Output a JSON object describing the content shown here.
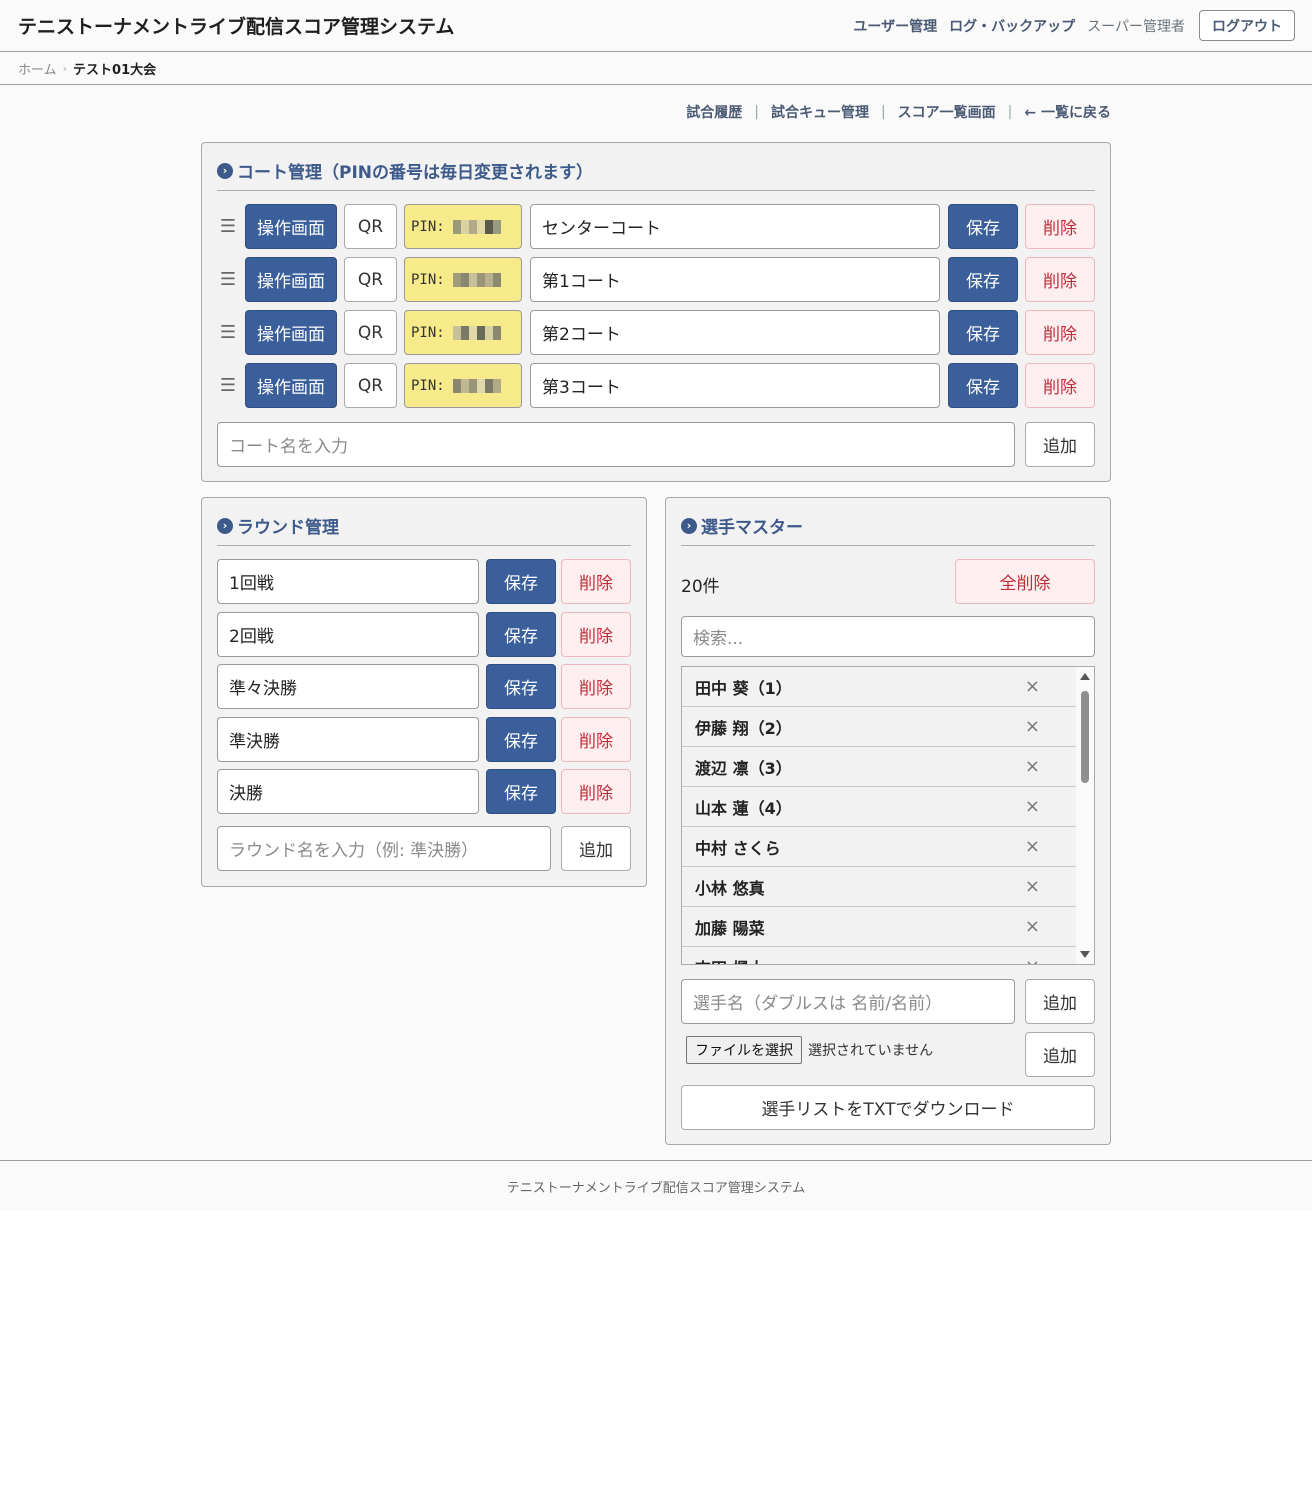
{
  "header": {
    "title": "テニストーナメントライブ配信スコア管理システム",
    "links": {
      "users": "ユーザー管理",
      "logs": "ログ・バックアップ"
    },
    "user_label": "スーパー管理者",
    "logout_label": "ログアウト"
  },
  "breadcrumb": {
    "home": "ホーム",
    "separator": "›",
    "current": "テスト01大会"
  },
  "subnav": {
    "history": "試合履歴",
    "queue": "試合キュー管理",
    "scores": "スコア一覧画面",
    "back": "← 一覧に戻る",
    "separator": "|"
  },
  "court_card": {
    "title": "コート管理（PINの番号は毎日変更されます）",
    "control_label": "操作画面",
    "qr_label": "QR",
    "pin_prefix": "PIN:",
    "save_label": "保存",
    "delete_label": "削除",
    "courts": [
      {
        "name": "センターコート"
      },
      {
        "name": "第1コート"
      },
      {
        "name": "第2コート"
      },
      {
        "name": "第3コート"
      }
    ],
    "new_placeholder": "コート名を入力",
    "add_label": "追加"
  },
  "round_card": {
    "title": "ラウンド管理",
    "save_label": "保存",
    "delete_label": "削除",
    "rounds": [
      "1回戦",
      "2回戦",
      "準々決勝",
      "準決勝",
      "決勝"
    ],
    "new_placeholder": "ラウンド名を入力（例: 準決勝）",
    "add_label": "追加"
  },
  "player_card": {
    "title": "選手マスター",
    "count": "20件",
    "delete_all_label": "全削除",
    "search_placeholder": "検索...",
    "players": [
      "田中 葵（1）",
      "伊藤 翔（2）",
      "渡辺 凛（3）",
      "山本 蓮（4）",
      "中村 さくら",
      "小林 悠真",
      "加藤 陽菜",
      "吉田 楓太"
    ],
    "remove_icon": "×",
    "name_placeholder": "選手名（ダブルスは 名前/名前）",
    "add_label": "追加",
    "file_button": "ファイルを選択",
    "file_status": "選択されていません",
    "file_add_label": "追加",
    "download_label": "選手リストをTXTでダウンロード"
  },
  "footer": {
    "text": "テニストーナメントライブ配信スコア管理システム"
  },
  "colors": {
    "primary": "#3a5f9a",
    "title": "#3d5a8a",
    "danger": "#c0303a",
    "pin_bg": "#f7ea8a"
  }
}
